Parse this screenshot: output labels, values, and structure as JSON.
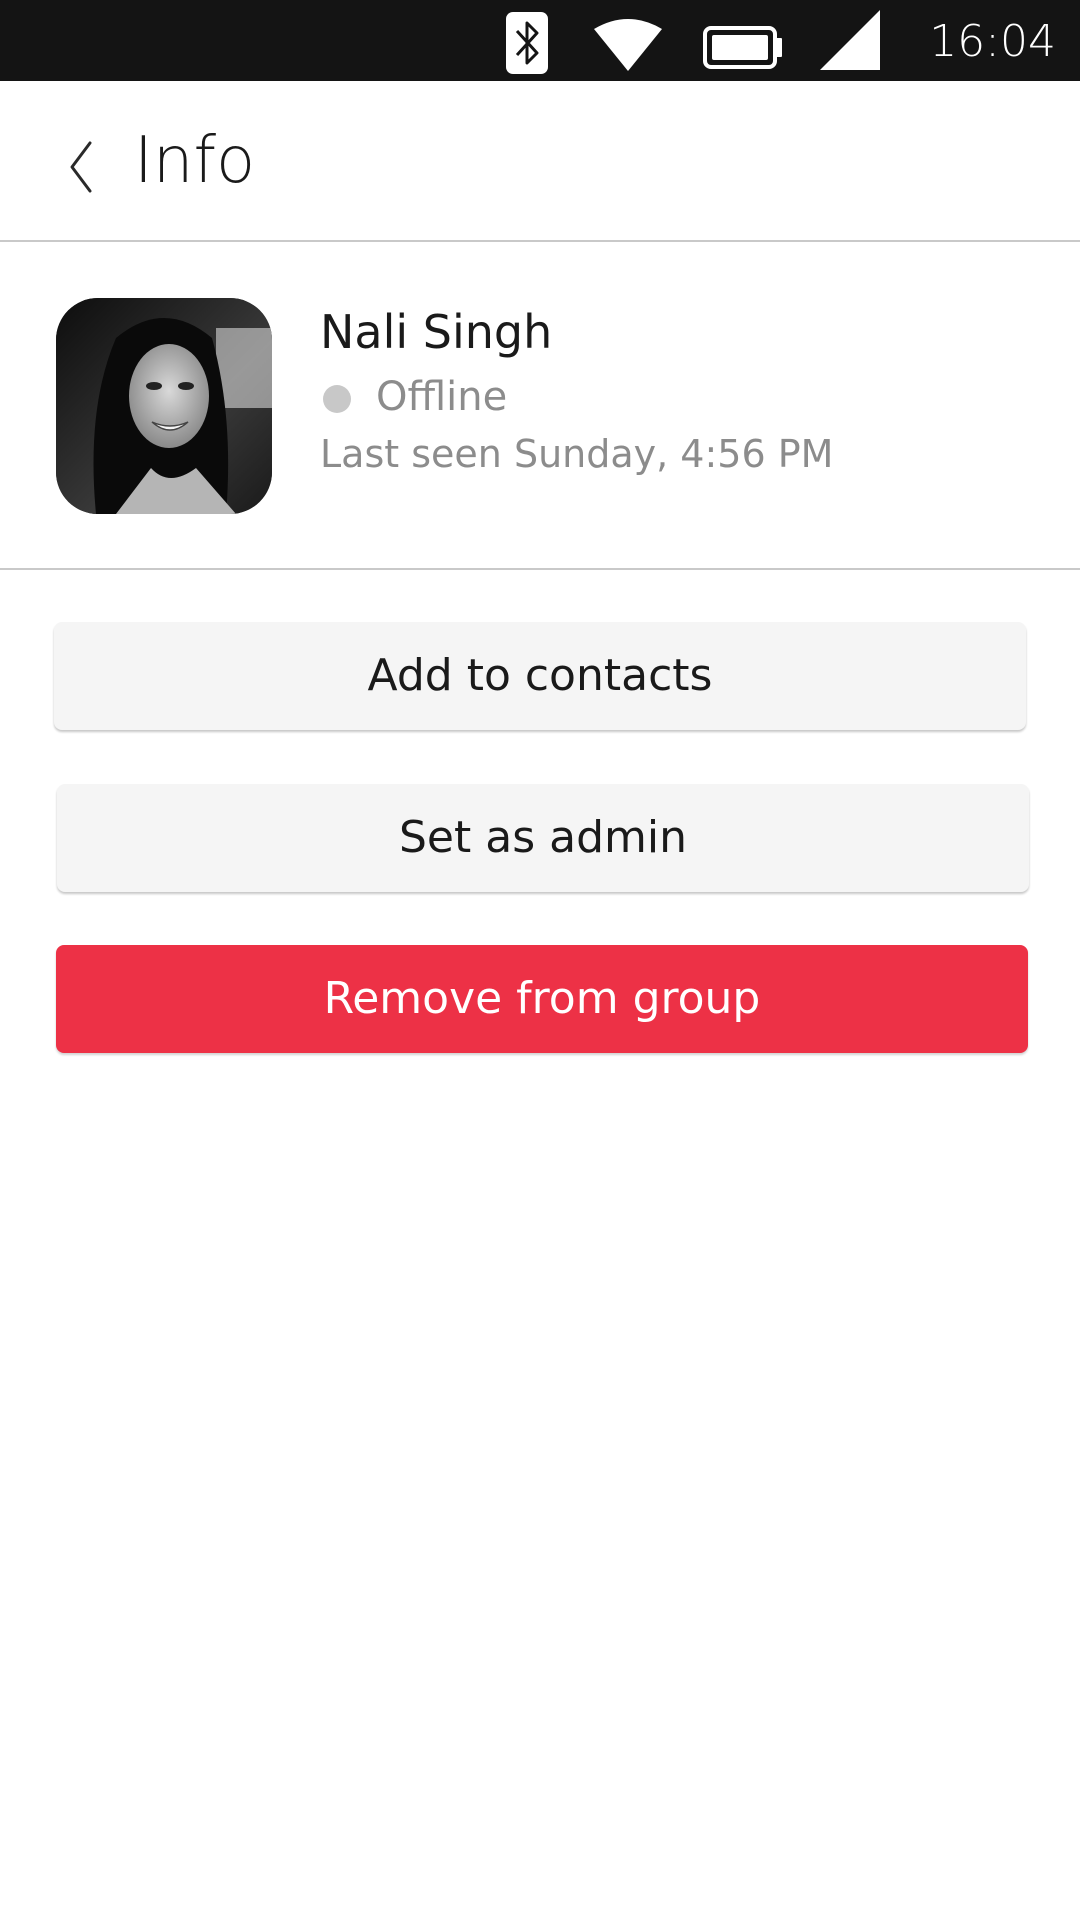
{
  "status_bar": {
    "time": "16:04",
    "icons": [
      "bluetooth-icon",
      "wifi-icon",
      "battery-icon",
      "cellular-signal-icon"
    ]
  },
  "header": {
    "back_icon": "chevron-left-icon",
    "title": "Info"
  },
  "contact": {
    "name": "Nali Singh",
    "presence": "Offline",
    "last_seen": "Last seen Sunday, 4:56 PM"
  },
  "actions": {
    "add_to_contacts": "Add to contacts",
    "set_as_admin": "Set as admin",
    "remove_from_group": "Remove from group"
  },
  "colors": {
    "status_bar_bg": "#141414",
    "danger": "#ed3146",
    "neutral_button": "#f5f5f5",
    "presence_dot": "#c8c8c8",
    "divider": "#c9c9c9"
  }
}
